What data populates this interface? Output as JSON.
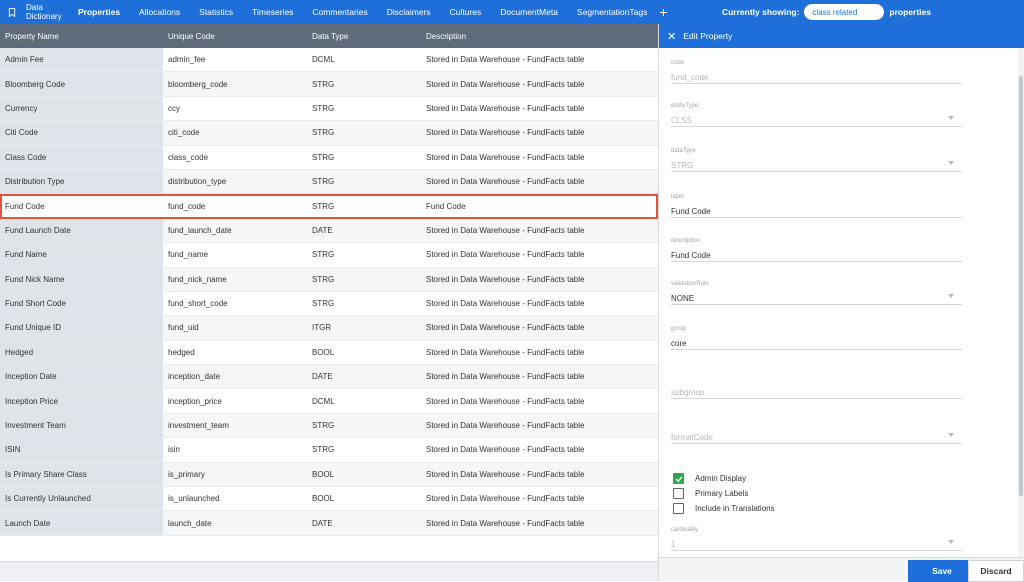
{
  "app": {
    "title_line1": "Data",
    "title_line2": "Dictionary",
    "tabs": [
      "Properties",
      "Allocations",
      "Statistics",
      "Timeseries",
      "Commentaries",
      "Disclaimers",
      "Cultures",
      "DocumentMeta",
      "SegmentationTags"
    ],
    "active_tab": "Properties",
    "add_label": "+",
    "showing_label": "Currently showing:",
    "showing_value": "class related",
    "showing_suffix": "properties"
  },
  "table": {
    "columns": [
      "Property Name",
      "Unique Code",
      "Data Type",
      "Description"
    ],
    "rows": [
      [
        "Admin Fee",
        "admin_fee",
        "DCML",
        "Stored in Data Warehouse - FundFacts table"
      ],
      [
        "Bloomberg Code",
        "bloomberg_code",
        "STRG",
        "Stored in Data Warehouse - FundFacts table"
      ],
      [
        "Currency",
        "ccy",
        "STRG",
        "Stored in Data Warehouse - FundFacts table"
      ],
      [
        "Citi Code",
        "citi_code",
        "STRG",
        "Stored in Data Warehouse - FundFacts table"
      ],
      [
        "Class Code",
        "class_code",
        "STRG",
        "Stored in Data Warehouse - FundFacts table"
      ],
      [
        "Distribution Type",
        "distribution_type",
        "STRG",
        "Stored in Data Warehouse - FundFacts table"
      ],
      [
        "Fund Code",
        "fund_code",
        "STRG",
        "Fund Code"
      ],
      [
        "Fund Launch Date",
        "fund_launch_date",
        "DATE",
        "Stored in Data Warehouse - FundFacts table"
      ],
      [
        "Fund Name",
        "fund_name",
        "STRG",
        "Stored in Data Warehouse - FundFacts table"
      ],
      [
        "Fund Nick Name",
        "fund_nick_name",
        "STRG",
        "Stored in Data Warehouse - FundFacts table"
      ],
      [
        "Fund Short Code",
        "fund_short_code",
        "STRG",
        "Stored in Data Warehouse - FundFacts table"
      ],
      [
        "Fund Unique ID",
        "fund_uid",
        "ITGR",
        "Stored in Data Warehouse - FundFacts table"
      ],
      [
        "Hedged",
        "hedged",
        "BOOL",
        "Stored in Data Warehouse - FundFacts table"
      ],
      [
        "Inception Date",
        "inception_date",
        "DATE",
        "Stored in Data Warehouse - FundFacts table"
      ],
      [
        "Inception Price",
        "inception_price",
        "DCML",
        "Stored in Data Warehouse - FundFacts table"
      ],
      [
        "Investment Team",
        "investment_team",
        "STRG",
        "Stored in Data Warehouse - FundFacts table"
      ],
      [
        "ISIN",
        "isin",
        "STRG",
        "Stored in Data Warehouse - FundFacts table"
      ],
      [
        "Is Primary Share Class",
        "is_primary",
        "BOOL",
        "Stored in Data Warehouse - FundFacts table"
      ],
      [
        "Is Currently Unlaunched",
        "is_unlaunched",
        "BOOL",
        "Stored in Data Warehouse - FundFacts table"
      ],
      [
        "Launch Date",
        "launch_date",
        "DATE",
        "Stored in Data Warehouse - FundFacts table"
      ]
    ],
    "selected_row": "Fund Code"
  },
  "panel": {
    "title": "Edit Property",
    "close_glyph": "✕",
    "fields": {
      "code": {
        "label": "code",
        "value": "fund_code"
      },
      "entityType": {
        "label": "entityType",
        "value": "CLSS"
      },
      "dataType": {
        "label": "dataType",
        "value": "STRG"
      },
      "label": {
        "label": "label",
        "value": "Fund Code"
      },
      "description": {
        "label": "description",
        "value": "Fund Code"
      },
      "validationRule": {
        "label": "validationRule",
        "value": "NONE"
      },
      "group": {
        "label": "group",
        "value": "core"
      },
      "subgroup": {
        "label": "",
        "value": "subgroup"
      },
      "formatCode": {
        "label": "",
        "value": "formatCode"
      },
      "cardinality": {
        "label": "cardinality",
        "value": "1"
      }
    },
    "checkboxes": [
      {
        "label": "Admin Display",
        "checked": true
      },
      {
        "label": "Primary Labels",
        "checked": false
      },
      {
        "label": "Include in Translations",
        "checked": false
      }
    ],
    "save_label": "Save",
    "discard_label": "Discard"
  },
  "colors": {
    "brand": "#1e6fd9",
    "header_gray": "#5f6b7a",
    "selection": "#e5533c",
    "check_green": "#2fa84f"
  }
}
